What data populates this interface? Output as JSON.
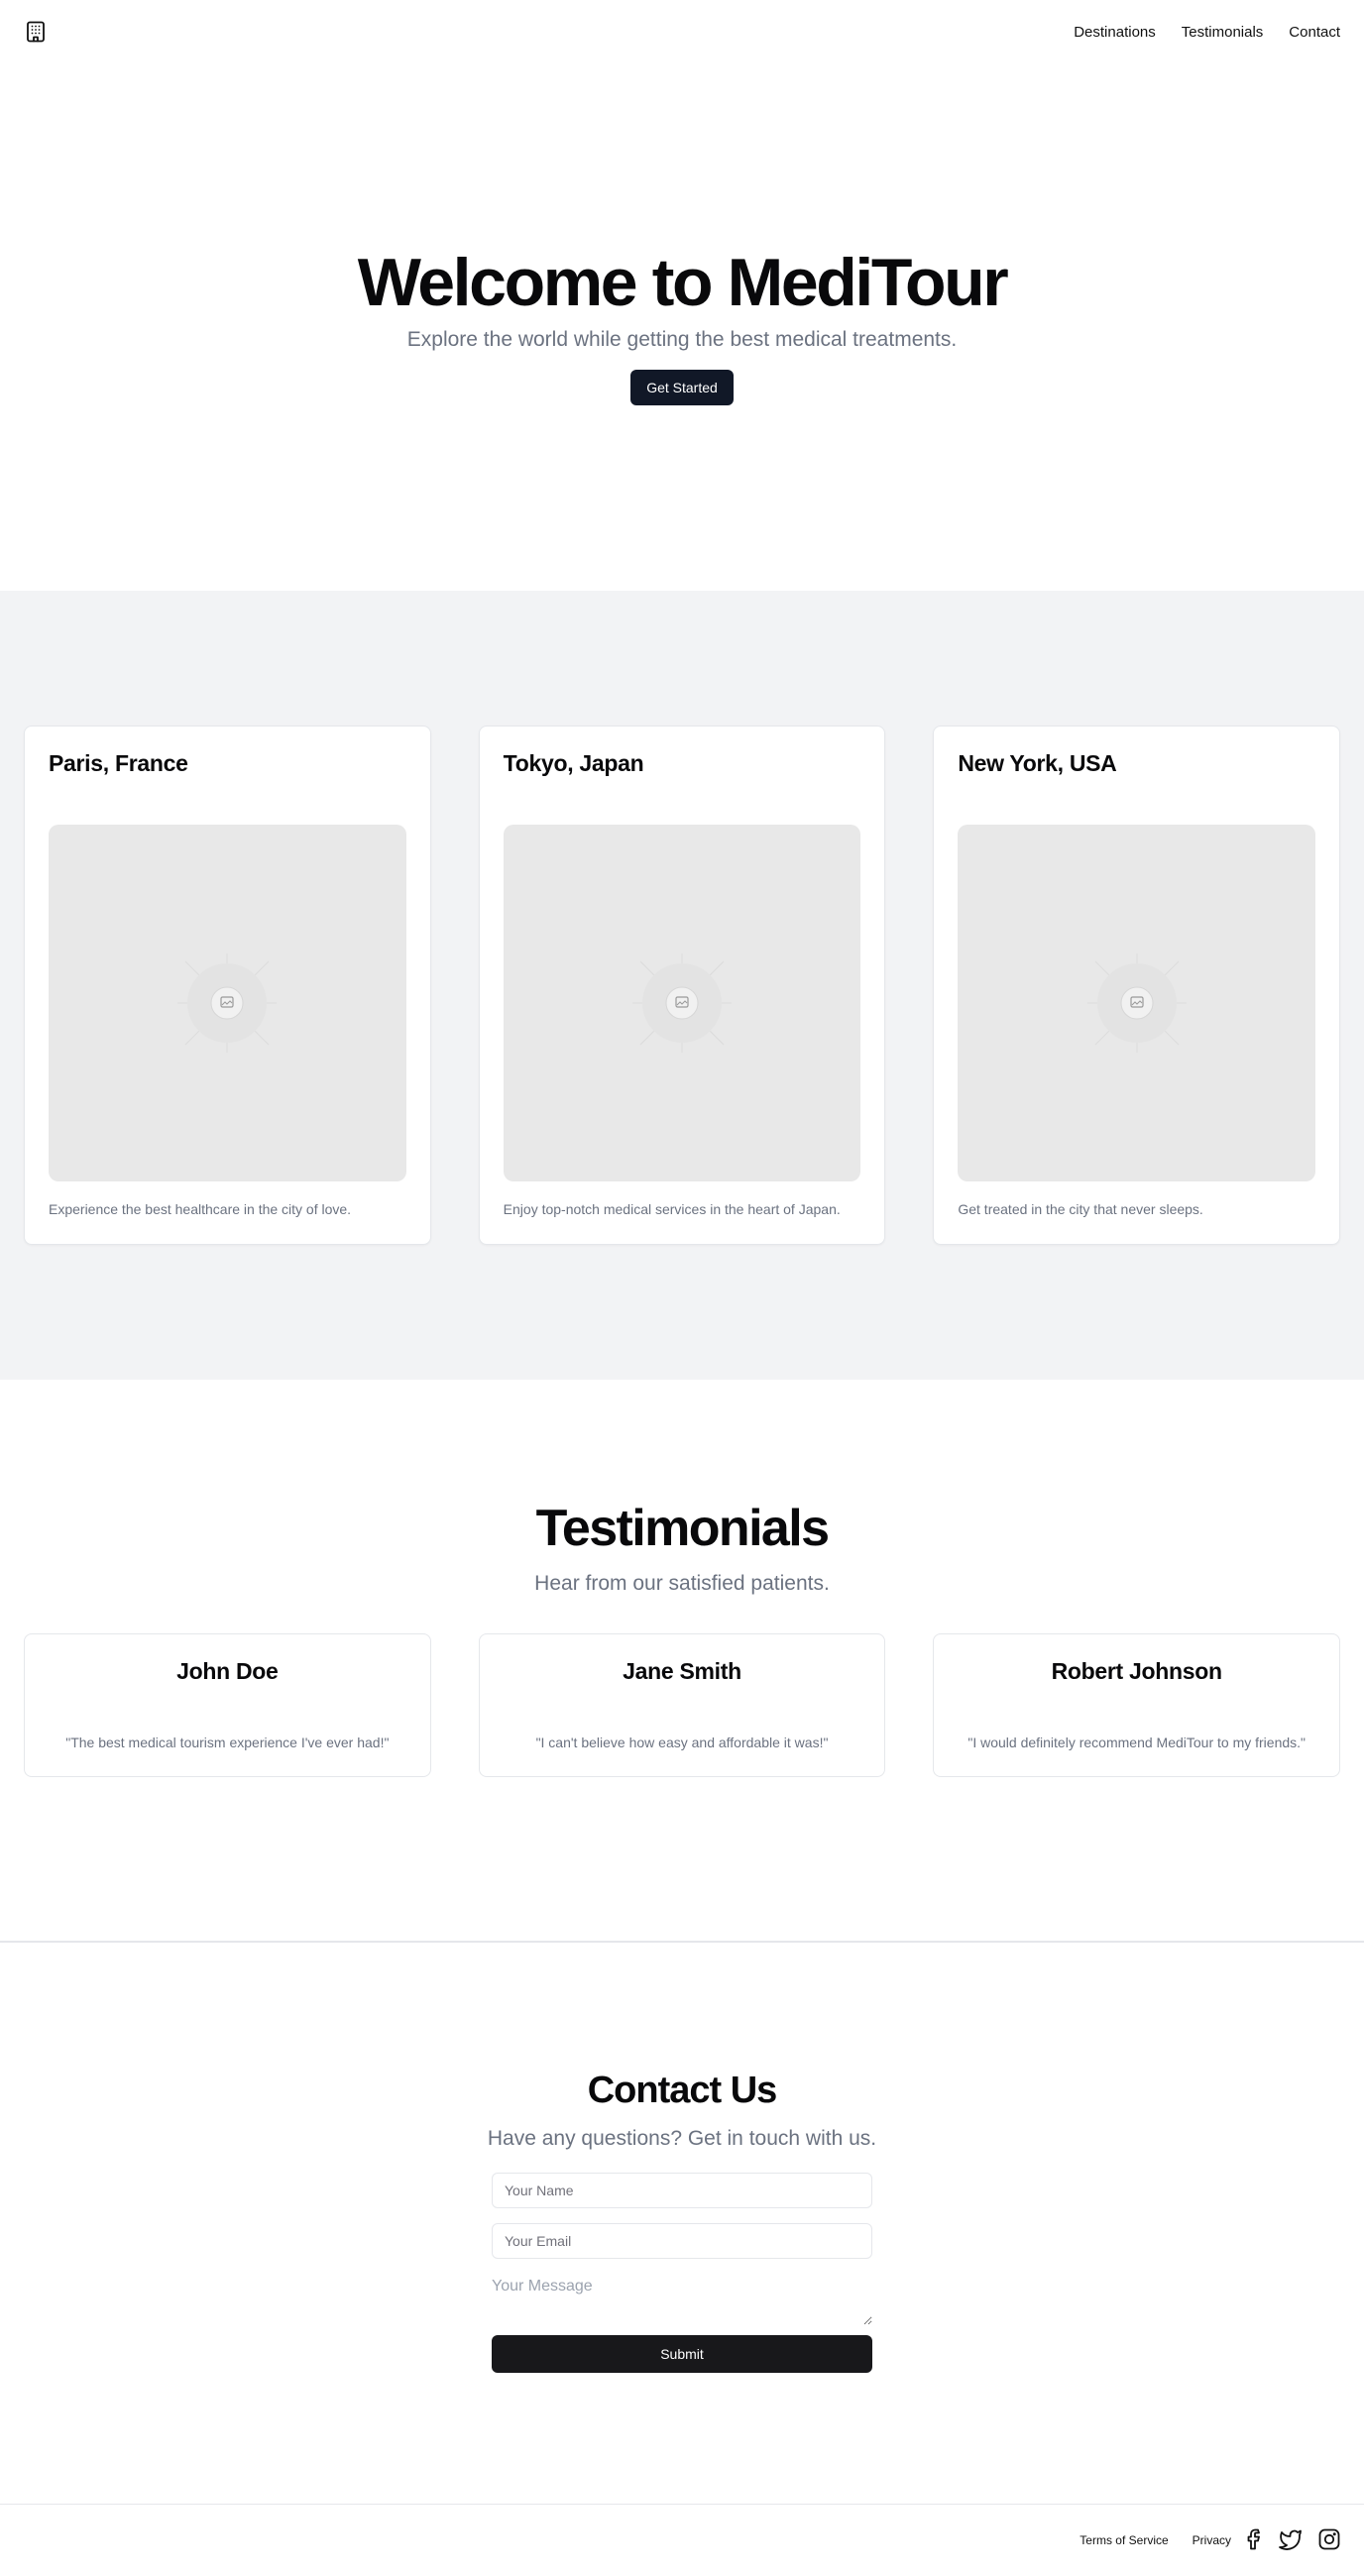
{
  "header": {
    "logo_icon": "building-icon",
    "nav": [
      {
        "label": "Destinations"
      },
      {
        "label": "Testimonials"
      },
      {
        "label": "Contact"
      }
    ]
  },
  "hero": {
    "title": "Welcome to MediTour",
    "subtitle": "Explore the world while getting the best medical treatments.",
    "cta_label": "Get Started"
  },
  "destinations": [
    {
      "title": "Paris, France",
      "description": "Experience the best healthcare in the city of love."
    },
    {
      "title": "Tokyo, Japan",
      "description": "Enjoy top-notch medical services in the heart of Japan."
    },
    {
      "title": "New York, USA",
      "description": "Get treated in the city that never sleeps."
    }
  ],
  "testimonials": {
    "title": "Testimonials",
    "subtitle": "Hear from our satisfied patients.",
    "items": [
      {
        "name": "John Doe",
        "quote": "\"The best medical tourism experience I've ever had!\""
      },
      {
        "name": "Jane Smith",
        "quote": "\"I can't believe how easy and affordable it was!\""
      },
      {
        "name": "Robert Johnson",
        "quote": "\"I would definitely recommend MediTour to my friends.\""
      }
    ]
  },
  "contact": {
    "title": "Contact Us",
    "subtitle": "Have any questions? Get in touch with us.",
    "name_placeholder": "Your Name",
    "email_placeholder": "Your Email",
    "message_placeholder": "Your Message",
    "submit_label": "Submit"
  },
  "footer": {
    "links": [
      {
        "label": "Terms of Service"
      },
      {
        "label": "Privacy"
      }
    ],
    "social_icons": [
      "facebook-icon",
      "twitter-icon",
      "instagram-icon"
    ]
  },
  "colors": {
    "primary_button": "#111827",
    "submit_button": "#18181b",
    "section_bg": "#f2f3f5",
    "muted_text": "#6b7280"
  }
}
